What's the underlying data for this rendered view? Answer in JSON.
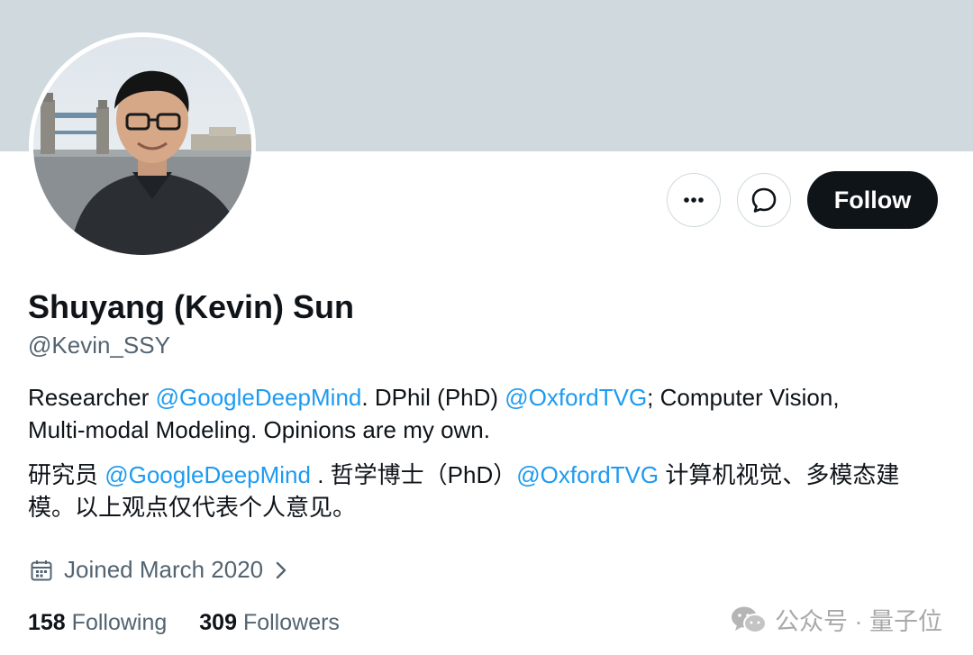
{
  "profile": {
    "display_name": "Shuyang (Kevin) Sun",
    "handle": "@Kevin_SSY"
  },
  "actions": {
    "follow_label": "Follow"
  },
  "bio_en": {
    "line1_prefix": "Researcher ",
    "line1_mention1": "@GoogleDeepMind",
    "line1_middle": ". DPhil (PhD) ",
    "line1_mention2": "@OxfordTVG",
    "line1_suffix": "; Computer Vision,",
    "line2": "Multi-modal Modeling. Opinions are my own."
  },
  "bio_zh": {
    "line1_prefix": "研究员 ",
    "line1_mention1": "@GoogleDeepMind",
    "line1_middle": " . 哲学博士（PhD）",
    "line1_mention2": "@OxfordTVG",
    "line1_suffix": " 计算机视觉、多模态建",
    "line2": "模。以上观点仅代表个人意见。"
  },
  "meta": {
    "joined": "Joined March 2020"
  },
  "stats": {
    "following_count": "158",
    "following_label": "Following",
    "followers_count": "309",
    "followers_label": "Followers"
  },
  "watermark": {
    "text": "公众号 · 量子位"
  },
  "icons": {
    "more": "more-horizontal-icon",
    "message": "message-bubble-icon",
    "calendar": "calendar-icon",
    "chevron": "chevron-right-icon",
    "wechat": "wechat-logo-icon"
  },
  "colors": {
    "banner": "#cfd9de",
    "link": "#1d9bf0",
    "primary_text": "#0f1419",
    "secondary_text": "#536471",
    "follow_bg": "#0f1419"
  }
}
